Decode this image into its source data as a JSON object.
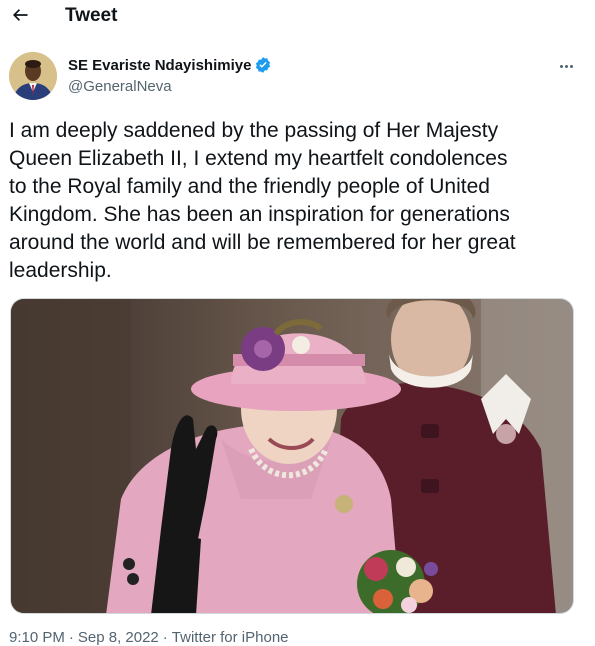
{
  "header": {
    "title": "Tweet",
    "back_icon": "arrow-left-icon"
  },
  "author": {
    "display_name": "SE Evariste Ndayishimiye",
    "handle": "@GeneralNeva",
    "verified_icon": "verified-badge-icon",
    "verified_color": "#1d9bf0"
  },
  "tweet": {
    "text": "I am deeply saddened by the passing of Her Majesty\nQueen Elizabeth II, I extend my heartfelt condolences\nto the Royal family and the friendly people of United\nKingdom. She has been an inspiration for generations\naround the world and will be remembered for her great\nleadership."
  },
  "meta": {
    "time": "9:10 PM",
    "separator": "·",
    "date": "Sep 8, 2022",
    "source": "Twitter for iPhone"
  },
  "colors": {
    "text_primary": "#0f1419",
    "text_secondary": "#536471",
    "accent": "#1d9bf0"
  }
}
